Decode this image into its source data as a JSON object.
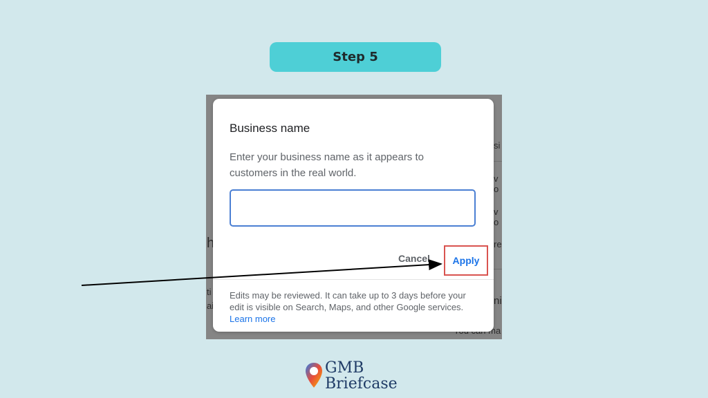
{
  "step_label": "Step 5",
  "background_fragments": [
    "si",
    "v o",
    "v o",
    "re",
    "h",
    "ni",
    "ti",
    "ai",
    "You can ma"
  ],
  "dialog": {
    "title": "Business name",
    "description": "Enter your business name as it appears to customers in the real world.",
    "input_value": "",
    "cancel_label": "Cancel",
    "apply_label": "Apply",
    "footer_text": "Edits may be reviewed. It can take up to 3 days before your edit is visible on Search, Maps, and other Google services.",
    "learn_more_label": "Learn more"
  },
  "logo": {
    "line1": "GMB",
    "line2": "Briefcase"
  },
  "colors": {
    "background": "#d2e8ec",
    "step_pill": "#4ecfd6",
    "accent_blue": "#1a73e8",
    "highlight_red": "#d9534f",
    "logo_navy": "#1f3b66"
  }
}
